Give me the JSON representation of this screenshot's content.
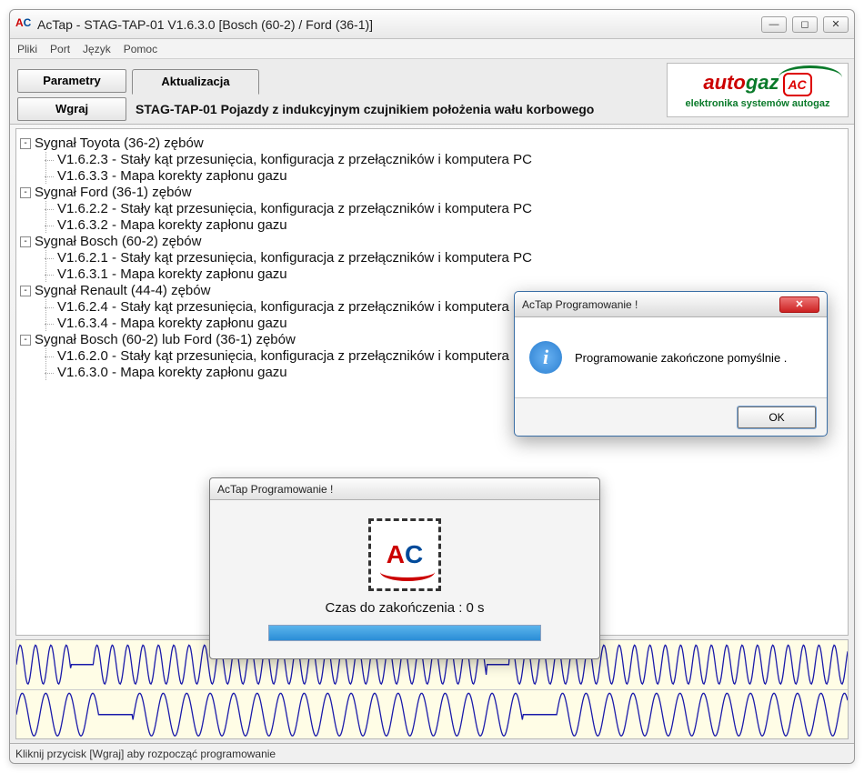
{
  "window": {
    "title": "AcTap  -  STAG-TAP-01 V1.6.3.0  [Bosch (60-2) / Ford (36-1)]"
  },
  "menu": {
    "items": [
      "Pliki",
      "Port",
      "Język",
      "Pomoc"
    ]
  },
  "toolbar": {
    "parametry": "Parametry",
    "aktualizacja": "Aktualizacja",
    "wgraj": "Wgraj",
    "description": "STAG-TAP-01  Pojazdy z indukcyjnym czujnikiem położenia wału korbowego"
  },
  "logo": {
    "auto": "auto",
    "gaz": "gaz",
    "ac": "AC",
    "sub": "elektronika systemów autogaz"
  },
  "tree": [
    {
      "label": "Sygnał Toyota (36-2) zębów",
      "children": [
        "V1.6.2.3 - Stały kąt przesunięcia, konfiguracja z przełączników i komputera PC",
        "V1.6.3.3 - Mapa korekty zapłonu gazu"
      ]
    },
    {
      "label": "Sygnał Ford (36-1) zębów",
      "children": [
        "V1.6.2.2 - Stały kąt przesunięcia, konfiguracja z przełączników i komputera PC",
        "V1.6.3.2 - Mapa korekty zapłonu gazu"
      ]
    },
    {
      "label": "Sygnał Bosch (60-2) zębów",
      "children": [
        "V1.6.2.1 - Stały kąt przesunięcia, konfiguracja z przełączników i komputera PC",
        "V1.6.3.1 - Mapa korekty zapłonu gazu"
      ]
    },
    {
      "label": "Sygnał Renault (44-4) zębów",
      "children": [
        "V1.6.2.4 - Stały kąt przesunięcia, konfiguracja z przełączników i komputera PC",
        "V1.6.3.4 - Mapa korekty zapłonu gazu"
      ]
    },
    {
      "label": "Sygnał Bosch (60-2) lub Ford (36-1) zębów",
      "children": [
        "V1.6.2.0 - Stały kąt przesunięcia, konfiguracja z przełączników i komputera PC",
        "V1.6.3.0 - Mapa korekty zapłonu gazu"
      ]
    }
  ],
  "progressDialog": {
    "title": "AcTap Programowanie !",
    "label": "Czas do zakończenia : 0 s",
    "percent": 100
  },
  "alertDialog": {
    "title": "AcTap Programowanie !",
    "message": "Programowanie zakończone pomyślnie .",
    "ok": "OK"
  },
  "status": "Kliknij przycisk [Wgraj] aby rozpocząć programowanie"
}
